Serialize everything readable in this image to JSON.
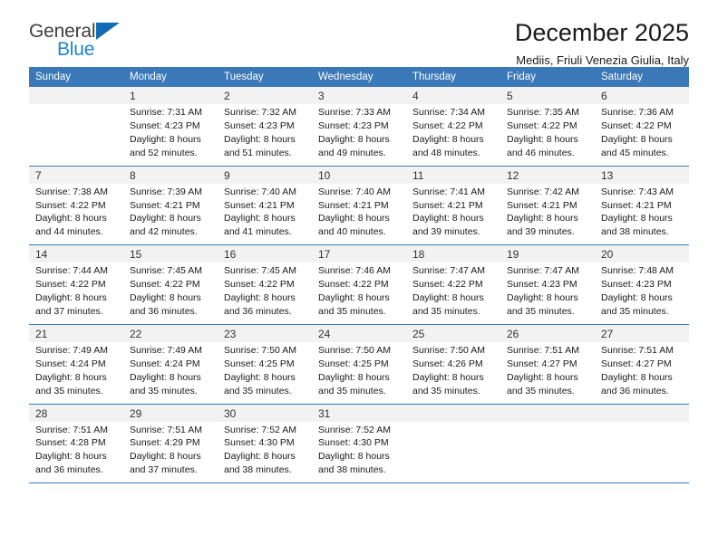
{
  "logo": {
    "word_top": "General",
    "word_bottom": "Blue",
    "triangle_color": "#0f6cb5",
    "top_color": "#3f3f3f",
    "bottom_color": "#1b83d4"
  },
  "header": {
    "title": "December 2025",
    "subtitle": "Mediis, Friuli Venezia Giulia, Italy"
  },
  "theme": {
    "header_bg": "#3b78b8",
    "header_text": "#ffffff",
    "daynum_bg": "#f2f2f2",
    "grid_line": "#3b78b8"
  },
  "weekdays": [
    "Sunday",
    "Monday",
    "Tuesday",
    "Wednesday",
    "Thursday",
    "Friday",
    "Saturday"
  ],
  "weeks": [
    [
      {
        "day": "",
        "lines": []
      },
      {
        "day": "1",
        "lines": [
          "Sunrise: 7:31 AM",
          "Sunset: 4:23 PM",
          "Daylight: 8 hours",
          "and 52 minutes."
        ]
      },
      {
        "day": "2",
        "lines": [
          "Sunrise: 7:32 AM",
          "Sunset: 4:23 PM",
          "Daylight: 8 hours",
          "and 51 minutes."
        ]
      },
      {
        "day": "3",
        "lines": [
          "Sunrise: 7:33 AM",
          "Sunset: 4:23 PM",
          "Daylight: 8 hours",
          "and 49 minutes."
        ]
      },
      {
        "day": "4",
        "lines": [
          "Sunrise: 7:34 AM",
          "Sunset: 4:22 PM",
          "Daylight: 8 hours",
          "and 48 minutes."
        ]
      },
      {
        "day": "5",
        "lines": [
          "Sunrise: 7:35 AM",
          "Sunset: 4:22 PM",
          "Daylight: 8 hours",
          "and 46 minutes."
        ]
      },
      {
        "day": "6",
        "lines": [
          "Sunrise: 7:36 AM",
          "Sunset: 4:22 PM",
          "Daylight: 8 hours",
          "and 45 minutes."
        ]
      }
    ],
    [
      {
        "day": "7",
        "lines": [
          "Sunrise: 7:38 AM",
          "Sunset: 4:22 PM",
          "Daylight: 8 hours",
          "and 44 minutes."
        ]
      },
      {
        "day": "8",
        "lines": [
          "Sunrise: 7:39 AM",
          "Sunset: 4:21 PM",
          "Daylight: 8 hours",
          "and 42 minutes."
        ]
      },
      {
        "day": "9",
        "lines": [
          "Sunrise: 7:40 AM",
          "Sunset: 4:21 PM",
          "Daylight: 8 hours",
          "and 41 minutes."
        ]
      },
      {
        "day": "10",
        "lines": [
          "Sunrise: 7:40 AM",
          "Sunset: 4:21 PM",
          "Daylight: 8 hours",
          "and 40 minutes."
        ]
      },
      {
        "day": "11",
        "lines": [
          "Sunrise: 7:41 AM",
          "Sunset: 4:21 PM",
          "Daylight: 8 hours",
          "and 39 minutes."
        ]
      },
      {
        "day": "12",
        "lines": [
          "Sunrise: 7:42 AM",
          "Sunset: 4:21 PM",
          "Daylight: 8 hours",
          "and 39 minutes."
        ]
      },
      {
        "day": "13",
        "lines": [
          "Sunrise: 7:43 AM",
          "Sunset: 4:21 PM",
          "Daylight: 8 hours",
          "and 38 minutes."
        ]
      }
    ],
    [
      {
        "day": "14",
        "lines": [
          "Sunrise: 7:44 AM",
          "Sunset: 4:22 PM",
          "Daylight: 8 hours",
          "and 37 minutes."
        ]
      },
      {
        "day": "15",
        "lines": [
          "Sunrise: 7:45 AM",
          "Sunset: 4:22 PM",
          "Daylight: 8 hours",
          "and 36 minutes."
        ]
      },
      {
        "day": "16",
        "lines": [
          "Sunrise: 7:45 AM",
          "Sunset: 4:22 PM",
          "Daylight: 8 hours",
          "and 36 minutes."
        ]
      },
      {
        "day": "17",
        "lines": [
          "Sunrise: 7:46 AM",
          "Sunset: 4:22 PM",
          "Daylight: 8 hours",
          "and 35 minutes."
        ]
      },
      {
        "day": "18",
        "lines": [
          "Sunrise: 7:47 AM",
          "Sunset: 4:22 PM",
          "Daylight: 8 hours",
          "and 35 minutes."
        ]
      },
      {
        "day": "19",
        "lines": [
          "Sunrise: 7:47 AM",
          "Sunset: 4:23 PM",
          "Daylight: 8 hours",
          "and 35 minutes."
        ]
      },
      {
        "day": "20",
        "lines": [
          "Sunrise: 7:48 AM",
          "Sunset: 4:23 PM",
          "Daylight: 8 hours",
          "and 35 minutes."
        ]
      }
    ],
    [
      {
        "day": "21",
        "lines": [
          "Sunrise: 7:49 AM",
          "Sunset: 4:24 PM",
          "Daylight: 8 hours",
          "and 35 minutes."
        ]
      },
      {
        "day": "22",
        "lines": [
          "Sunrise: 7:49 AM",
          "Sunset: 4:24 PM",
          "Daylight: 8 hours",
          "and 35 minutes."
        ]
      },
      {
        "day": "23",
        "lines": [
          "Sunrise: 7:50 AM",
          "Sunset: 4:25 PM",
          "Daylight: 8 hours",
          "and 35 minutes."
        ]
      },
      {
        "day": "24",
        "lines": [
          "Sunrise: 7:50 AM",
          "Sunset: 4:25 PM",
          "Daylight: 8 hours",
          "and 35 minutes."
        ]
      },
      {
        "day": "25",
        "lines": [
          "Sunrise: 7:50 AM",
          "Sunset: 4:26 PM",
          "Daylight: 8 hours",
          "and 35 minutes."
        ]
      },
      {
        "day": "26",
        "lines": [
          "Sunrise: 7:51 AM",
          "Sunset: 4:27 PM",
          "Daylight: 8 hours",
          "and 35 minutes."
        ]
      },
      {
        "day": "27",
        "lines": [
          "Sunrise: 7:51 AM",
          "Sunset: 4:27 PM",
          "Daylight: 8 hours",
          "and 36 minutes."
        ]
      }
    ],
    [
      {
        "day": "28",
        "lines": [
          "Sunrise: 7:51 AM",
          "Sunset: 4:28 PM",
          "Daylight: 8 hours",
          "and 36 minutes."
        ]
      },
      {
        "day": "29",
        "lines": [
          "Sunrise: 7:51 AM",
          "Sunset: 4:29 PM",
          "Daylight: 8 hours",
          "and 37 minutes."
        ]
      },
      {
        "day": "30",
        "lines": [
          "Sunrise: 7:52 AM",
          "Sunset: 4:30 PM",
          "Daylight: 8 hours",
          "and 38 minutes."
        ]
      },
      {
        "day": "31",
        "lines": [
          "Sunrise: 7:52 AM",
          "Sunset: 4:30 PM",
          "Daylight: 8 hours",
          "and 38 minutes."
        ]
      },
      {
        "day": "",
        "lines": []
      },
      {
        "day": "",
        "lines": []
      },
      {
        "day": "",
        "lines": []
      }
    ]
  ]
}
